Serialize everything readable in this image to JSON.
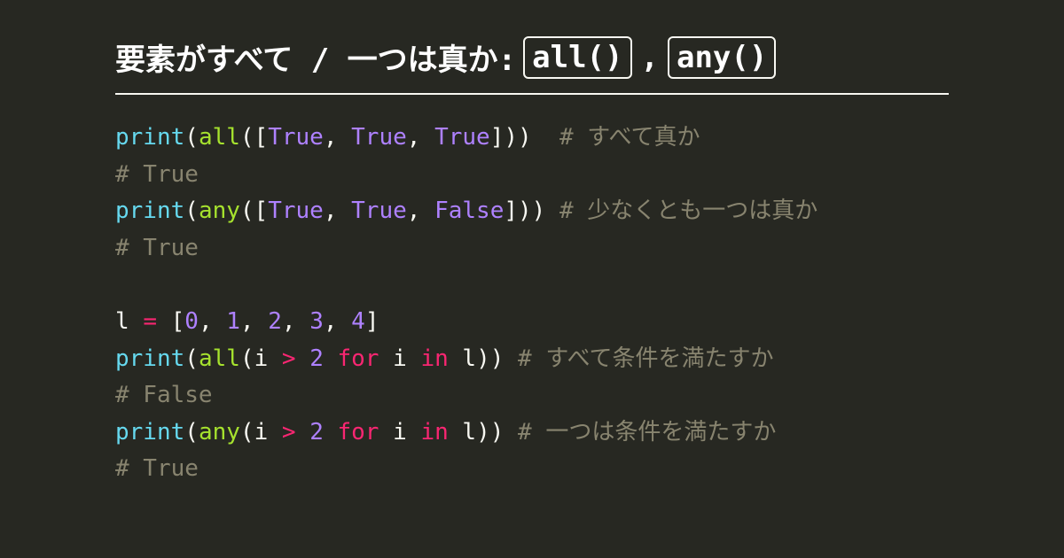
{
  "heading": {
    "prefix": "要素がすべて / 一つは真か: ",
    "box1": "all()",
    "sep": ",",
    "box2": "any()"
  },
  "code": {
    "l1": {
      "fn": "print",
      "builtin": "all",
      "args": "[True, True, True]",
      "trail": "  ",
      "comment": "# すべて真か"
    },
    "l2": {
      "text": "# True"
    },
    "l3": {
      "fn": "print",
      "builtin": "any",
      "args": "[True, True, False]",
      "trail": " ",
      "comment": "# 少なくとも一つは真か"
    },
    "l4": {
      "text": "# True"
    },
    "l5": {
      "text": ""
    },
    "l6": {
      "var": "l",
      "op": "=",
      "list": "[0, 1, 2, 3, 4]"
    },
    "l7": {
      "fn": "print",
      "builtin": "all",
      "expr_var1": "i",
      "expr_op": ">",
      "expr_num": "2",
      "kw_for": "for",
      "expr_var2": "i",
      "kw_in": "in",
      "expr_var3": "l",
      "trail": " ",
      "comment": "# すべて条件を満たすか"
    },
    "l8": {
      "text": "# False"
    },
    "l9": {
      "fn": "print",
      "builtin": "any",
      "expr_var1": "i",
      "expr_op": ">",
      "expr_num": "2",
      "kw_for": "for",
      "expr_var2": "i",
      "kw_in": "in",
      "expr_var3": "l",
      "trail": " ",
      "comment": "# 一つは条件を満たすか"
    },
    "l10": {
      "text": "# True"
    }
  }
}
